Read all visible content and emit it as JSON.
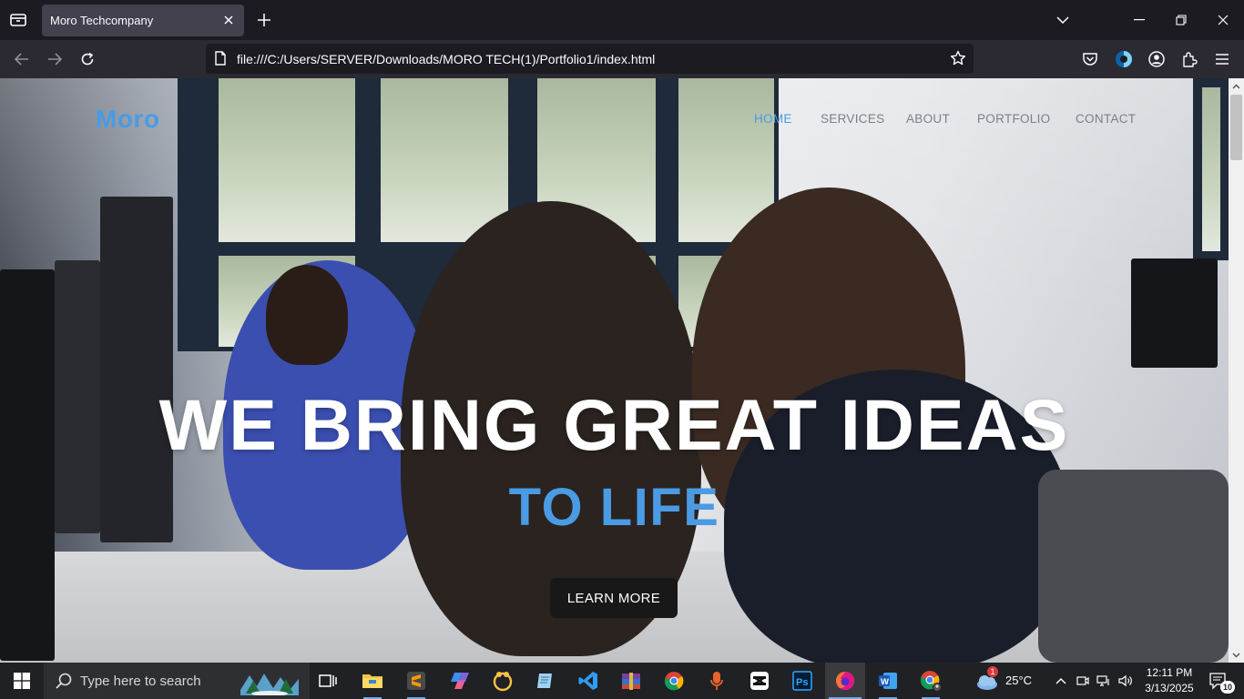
{
  "browser": {
    "tab_title": "Moro Techcompany",
    "url": "file:///C:/Users/SERVER/Downloads/MORO TECH(1)/Portfolio1/index.html"
  },
  "site": {
    "brand": "Moro",
    "nav": [
      {
        "label": "HOME",
        "active": true
      },
      {
        "label": "SERVICES",
        "active": false
      },
      {
        "label": "ABOUT",
        "active": false
      },
      {
        "label": "PORTFOLIO",
        "active": false
      },
      {
        "label": "CONTACT",
        "active": false
      }
    ],
    "hero": {
      "headline": "WE BRING GREAT IDEAS",
      "subline": "TO LIFE",
      "cta": "LEARN MORE"
    },
    "colors": {
      "accent": "#4a9be3",
      "button_bg": "#181818"
    }
  },
  "taskbar": {
    "search_placeholder": "Type here to search",
    "weather_temp": "25°C",
    "weather_badge": "1",
    "time": "12:11 PM",
    "date": "3/13/2025",
    "notification_count": "10",
    "apps": [
      "task-view",
      "file-explorer",
      "sublime-text",
      "copilot",
      "norton",
      "notepad",
      "vscode",
      "winrar",
      "chrome",
      "voice-recorder",
      "capcut",
      "photoshop",
      "firefox",
      "word",
      "chrome-profile"
    ]
  }
}
